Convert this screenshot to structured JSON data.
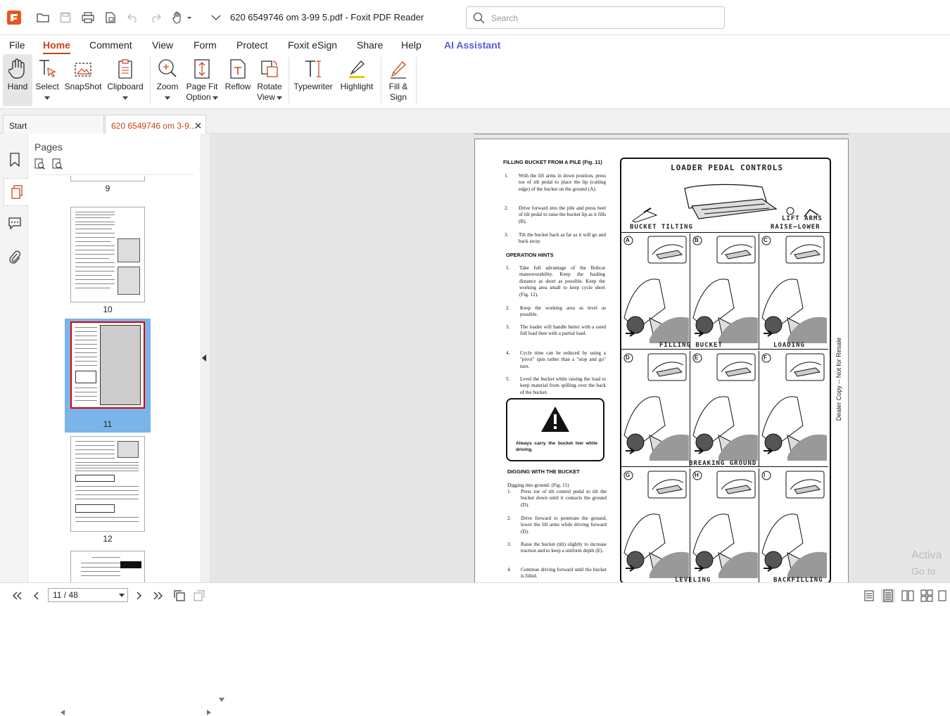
{
  "app": {
    "title": "620 6549746 om 3-99 5.pdf - Foxit PDF Reader",
    "accent_color": "#c8441a"
  },
  "search": {
    "placeholder": "Search"
  },
  "menu": [
    "File",
    "Home",
    "Comment",
    "View",
    "Form",
    "Protect",
    "Foxit eSign",
    "Share",
    "Help",
    "AI Assistant"
  ],
  "ribbon": {
    "hand": "Hand",
    "select": "Select",
    "snapshot": "SnapShot",
    "clipboard": "Clipboard",
    "zoom": "Zoom",
    "pagefit_1": "Page Fit",
    "pagefit_2": "Option",
    "reflow": "Reflow",
    "rotate_1": "Rotate",
    "rotate_2": "View",
    "typewriter": "Typewriter",
    "highlight": "Highlight",
    "fill_1": "Fill &",
    "fill_2": "Sign"
  },
  "tabs": {
    "start": "Start",
    "doc": "620 6549746 om 3-9..."
  },
  "pages_panel": {
    "title": "Pages",
    "page_numbers": [
      "9",
      "10",
      "11",
      "12"
    ]
  },
  "pdf": {
    "heading1": "FILLING BUCKET FROM A PILE (Fig. 11)",
    "steps1": [
      {
        "n": "1.",
        "t": "With the lift arms in down position, press toe of tilt pedal to place the lip (cutting edge) of the bucket on the ground (A)."
      },
      {
        "n": "2.",
        "t": "Drive forward into the pile and press heel of tilt pedal to raise the bucket lip as it fills (B)."
      },
      {
        "n": "3.",
        "t": "Tilt the bucket back as far as it will go and back away."
      }
    ],
    "heading2": "OPERATION HINTS",
    "steps2": [
      {
        "n": "1.",
        "t": "Take full advantage of the Bobcat maneuverability. Keep the hauling distance as short as possible. Keep the working area small to keep cycle short (Fig. 12)."
      },
      {
        "n": "2.",
        "t": "Keep the working area as level as possible."
      },
      {
        "n": "3.",
        "t": "The loader will handle better with a rated full load then with a partial load."
      },
      {
        "n": "4.",
        "t": "Cycle time can be reduced by using a \"pivot\" spin rather than a \"stop and go\" turn."
      },
      {
        "n": "5.",
        "t": "Level the bucket while raising the load to keep material from spilling over the back of the bucket."
      }
    ],
    "warning": "Always carry the bucket low while driving.",
    "heading3": "DIGGING WITH THE BUCKET",
    "sub3": "Digging into ground: (Fig. 11)",
    "steps3": [
      {
        "n": "1.",
        "t": "Press toe of tilt control pedal to tilt the bucket down until it contacts the ground (D)."
      },
      {
        "n": "2.",
        "t": "Drive forward to penetrate the ground, lower the lift arms while driving forward (D)."
      },
      {
        "n": "3.",
        "t": "Raise the bucket (tilt) slightly to increase traction and to keep a uniform depth (E)."
      },
      {
        "n": "4.",
        "t": "Continue driving forward until the bucket is filled."
      }
    ],
    "figure": {
      "title": "LOADER PEDAL CONTROLS",
      "bucket_tilting": "BUCKET TILTING",
      "lift_arms_1": "LIFT ARMS",
      "lift_arms_2": "RAISE—LOWER",
      "letters": [
        "A",
        "B",
        "C",
        "D",
        "E",
        "F",
        "G",
        "H",
        "I"
      ],
      "filling_bucket": "FILLING BUCKET",
      "loading": "LOADING",
      "breaking_ground": "BREAKING GROUND",
      "leveling": "LEVELING",
      "backfilling": "BACKFILLING"
    },
    "side_note": "Dealer Copy -- Not for Resale"
  },
  "watermark": {
    "line1": "Activa",
    "line2": "Go to Se"
  },
  "status": {
    "page_indicator": "11 / 48"
  }
}
